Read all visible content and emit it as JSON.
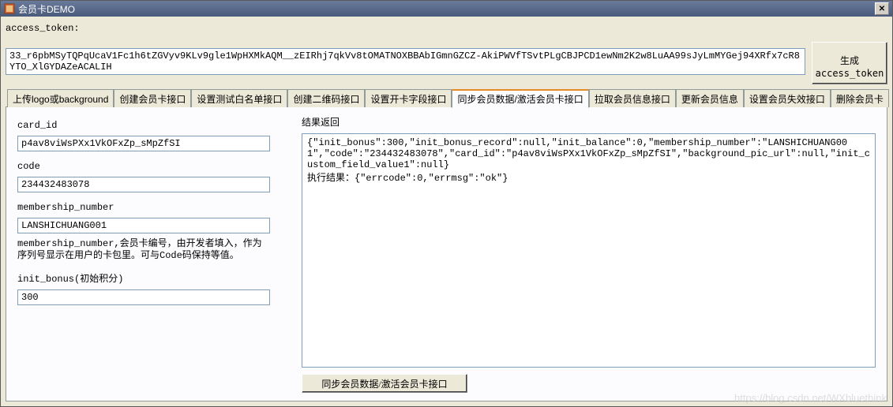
{
  "window": {
    "title": "会员卡DEMO"
  },
  "token": {
    "label": "access_token:",
    "value": "33_r6pbMSyTQPqUcaV1Fc1h6tZGVyv9KLv9gle1WpHXMkAQM__zEIRhj7qkVv8tOMATNOXBBAbIGmnGZCZ-AkiPWVfTSvtPLgCBJPCD1ewNm2K2w8LuAA99sJyLmMYGej94XRfx7cR8YTO_XlGYDAZeACALIH",
    "generate_label": "生成\naccess_token"
  },
  "tabs": [
    {
      "label": "上传logo或background"
    },
    {
      "label": "创建会员卡接口"
    },
    {
      "label": "设置测试白名单接口"
    },
    {
      "label": "创建二维码接口"
    },
    {
      "label": "设置开卡字段接口"
    },
    {
      "label": "同步会员数据/激活会员卡接口"
    },
    {
      "label": "拉取会员信息接口"
    },
    {
      "label": "更新会员信息"
    },
    {
      "label": "设置会员失效接口"
    },
    {
      "label": "删除会员卡"
    }
  ],
  "active_tab_index": 5,
  "form": {
    "card_id": {
      "label": "card_id",
      "value": "p4av8viWsPXx1VkOFxZp_sMpZfSI"
    },
    "code": {
      "label": "code",
      "value": "234432483078"
    },
    "membership_number": {
      "label": "membership_number",
      "value": "LANSHICHUANG001"
    },
    "membership_hint": "membership_number,会员卡编号，由开发者填入，作为序列号显示在用户的卡包里。可与Code码保持等值。",
    "init_bonus": {
      "label": "init_bonus(初始积分)",
      "value": "300"
    }
  },
  "result": {
    "label": "结果返回",
    "text": "{\"init_bonus\":300,\"init_bonus_record\":null,\"init_balance\":0,\"membership_number\":\"LANSHICHUANG001\",\"code\":\"234432483078\",\"card_id\":\"p4av8viWsPXx1VkOFxZp_sMpZfSI\",\"background_pic_url\":null,\"init_custom_field_value1\":null}\n执行结果：{\"errcode\":0,\"errmsg\":\"ok\"}"
  },
  "sync_button": "同步会员数据/激活会员卡接口",
  "watermark": "https://blog.csdn.net/WXbluethink"
}
